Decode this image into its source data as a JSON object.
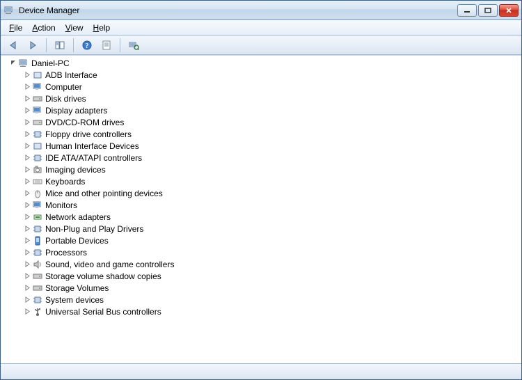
{
  "window": {
    "title": "Device Manager"
  },
  "menu": {
    "file": "File",
    "action": "Action",
    "view": "View",
    "help": "Help"
  },
  "toolbar": {
    "back": "back",
    "forward": "forward",
    "show_hide": "show-hide-console-tree",
    "help": "help",
    "scan": "scan-for-hardware-changes",
    "properties": "properties"
  },
  "tree": {
    "root": "Daniel-PC",
    "items": [
      "ADB Interface",
      "Computer",
      "Disk drives",
      "Display adapters",
      "DVD/CD-ROM drives",
      "Floppy drive controllers",
      "Human Interface Devices",
      "IDE ATA/ATAPI controllers",
      "Imaging devices",
      "Keyboards",
      "Mice and other pointing devices",
      "Monitors",
      "Network adapters",
      "Non-Plug and Play Drivers",
      "Portable Devices",
      "Processors",
      "Sound, video and game controllers",
      "Storage volume shadow copies",
      "Storage Volumes",
      "System devices",
      "Universal Serial Bus controllers"
    ]
  }
}
